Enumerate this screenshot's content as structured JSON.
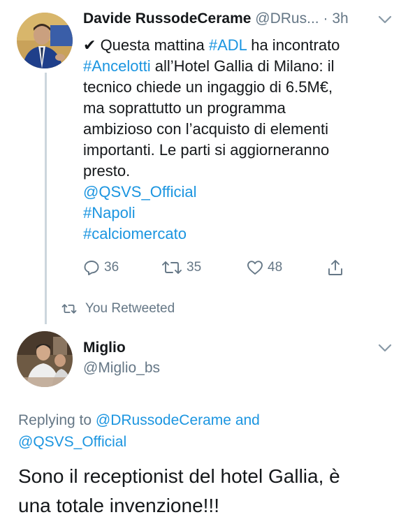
{
  "tweet1": {
    "author_name": "Davide RussodeCerame",
    "author_handle": "@DRus...",
    "separator": "·",
    "time": "3h",
    "body": {
      "check": "✔",
      "l1_a": "Questa mattina",
      "l1_tag": "#ADL",
      "l1_b": "ha incontrato",
      "l2_tag": "#Ancelotti",
      "l2_b": "all’Hotel Gallia di Milano: il",
      "l3": "tecnico chiede un ingaggio di 6.5M€,",
      "l4": "ma soprattutto un programma",
      "l5": "ambizioso con l’acquisto di elementi",
      "l6": "importanti. Le parti si aggiorneranno",
      "l7": "presto.",
      "mention": "@QSVS_Official",
      "hashtag1": "#Napoli",
      "hashtag2": "#calciomercato"
    },
    "actions": {
      "replies": "36",
      "retweets": "35",
      "likes": "48"
    }
  },
  "retweet_note": "You Retweeted",
  "tweet2": {
    "author_name": "Miglio",
    "author_handle": "@Miglio_bs",
    "replying_prefix": "Replying to",
    "replying_user1": "@DRussodeCerame",
    "replying_and": "and",
    "replying_user2": "@QSVS_Official",
    "text_line1": "Sono il receptionist del hotel Gallia, è",
    "text_line2": "una totale invenzione!!!"
  },
  "colors": {
    "link": "#1b95e0",
    "secondary_text": "#657786",
    "primary_text": "#14171a",
    "thread_line": "#ccd6dd"
  },
  "icons": [
    "chevron-down-icon",
    "reply-icon",
    "retweet-icon",
    "like-icon",
    "share-icon",
    "retweeted-icon"
  ]
}
